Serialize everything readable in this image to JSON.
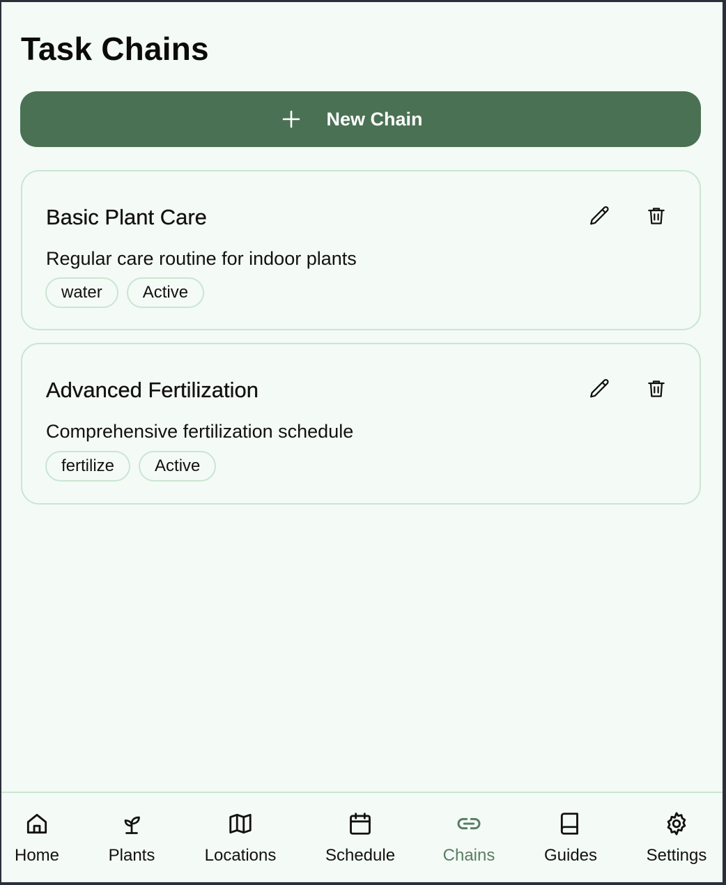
{
  "page": {
    "title": "Task Chains"
  },
  "new_chain_button": {
    "label": "New Chain",
    "icon": "plus-icon"
  },
  "chains": [
    {
      "title": "Basic Plant Care",
      "description": "Regular care routine for indoor plants",
      "tags": [
        "water",
        "Active"
      ]
    },
    {
      "title": "Advanced Fertilization",
      "description": "Comprehensive fertilization schedule",
      "tags": [
        "fertilize",
        "Active"
      ]
    }
  ],
  "nav": {
    "items": [
      {
        "label": "Home",
        "icon": "home-icon"
      },
      {
        "label": "Plants",
        "icon": "sprout-icon"
      },
      {
        "label": "Locations",
        "icon": "map-icon"
      },
      {
        "label": "Schedule",
        "icon": "calendar-icon"
      },
      {
        "label": "Chains",
        "icon": "link-icon"
      },
      {
        "label": "Guides",
        "icon": "book-icon"
      },
      {
        "label": "Settings",
        "icon": "gear-icon"
      }
    ],
    "active": "Chains"
  },
  "colors": {
    "background": "#f4faf6",
    "accent": "#4a7153",
    "border": "#c9e6d2",
    "active_nav": "#5a7d63"
  }
}
